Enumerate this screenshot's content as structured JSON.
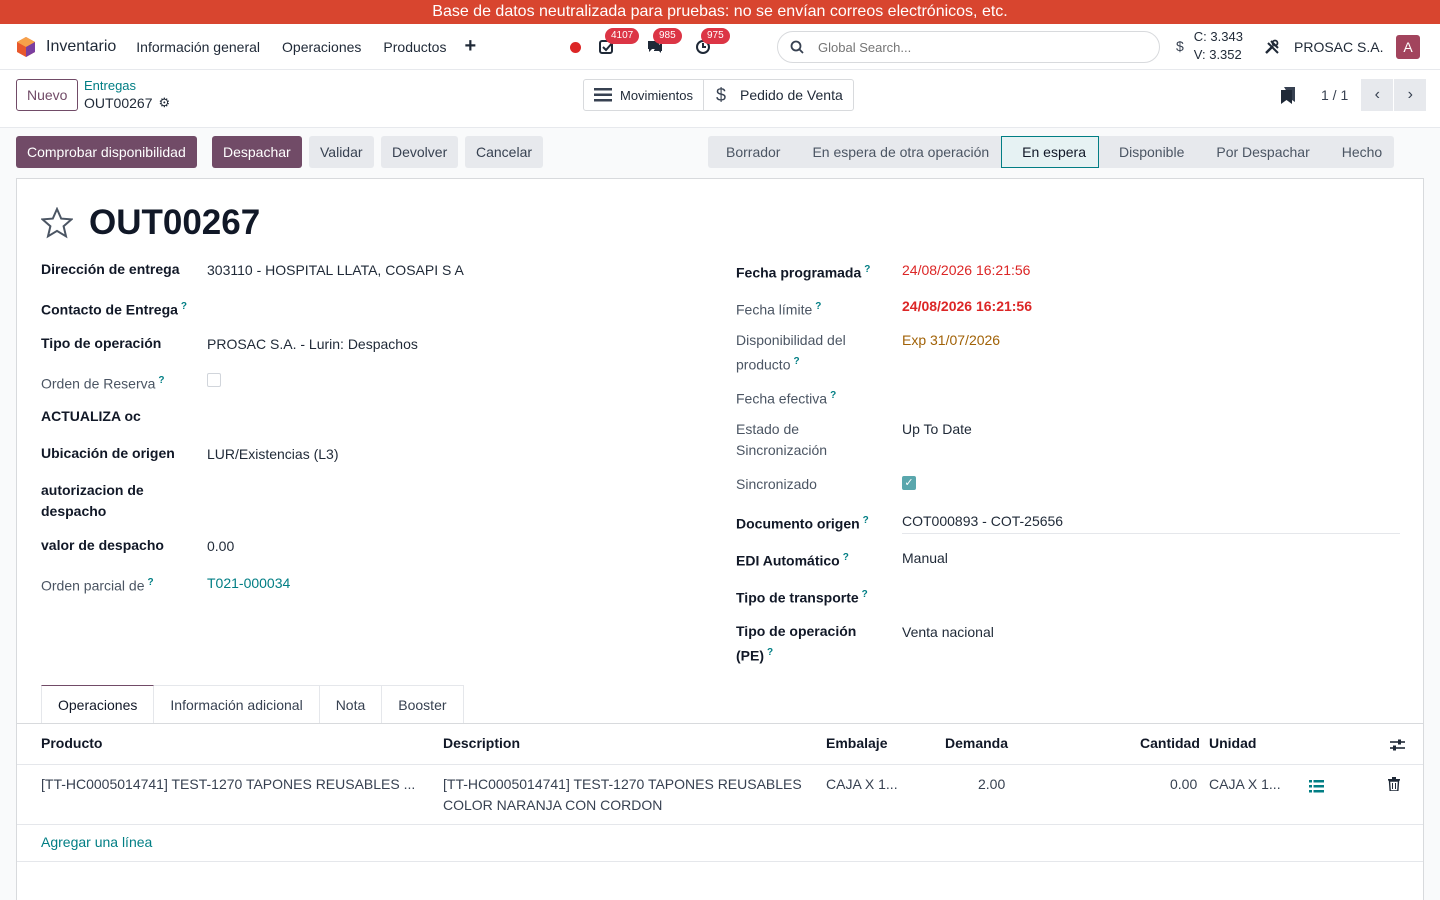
{
  "banner": "Base de datos neutralizada para pruebas: no se envían correos electrónicos, etc.",
  "nav": {
    "app_name": "Inventario",
    "menus": [
      "Información general",
      "Operaciones",
      "Productos"
    ],
    "plus_icon": "plus-icon",
    "activity_count": "4107",
    "messages_count": "985",
    "timer_count": "975",
    "search_placeholder": "Global Search...",
    "rate_c": "C: 3.343",
    "rate_v": "V: 3.352",
    "currency_symbol": "$",
    "company": "PROSAC S.A.",
    "avatar_letter": "A"
  },
  "control": {
    "new_label": "Nuevo",
    "breadcrumb_parent": "Entregas",
    "breadcrumb_current": "OUT00267",
    "smart_moves": "Movimientos",
    "smart_sale": "Pedido de Venta",
    "pager": "1 / 1"
  },
  "actions": {
    "check": "Comprobar disponibilidad",
    "dispatch": "Despachar",
    "validate": "Validar",
    "return": "Devolver",
    "cancel": "Cancelar"
  },
  "status": [
    "Borrador",
    "En espera de otra operación",
    "En espera",
    "Disponible",
    "Por Despachar",
    "Hecho"
  ],
  "status_active": "En espera",
  "record": {
    "title": "OUT00267",
    "left": {
      "delivery_address_label": "Dirección de entrega",
      "delivery_address": "303110 - HOSPITAL LLATA, COSAPI S A",
      "contact_label": "Contacto de Entrega",
      "op_type_label": "Tipo de operación",
      "op_type": "PROSAC S.A. - Lurin: Despachos",
      "reserve_label": "Orden de Reserva",
      "update_oc_label": "ACTUALIZA oc",
      "source_loc_label": "Ubicación de origen",
      "source_loc": "LUR/Existencias (L3)",
      "auth_label_1": "autorizacion de",
      "auth_label_2": "despacho",
      "dispatch_value_label": "valor de despacho",
      "dispatch_value": "0.00",
      "partial_label": "Orden parcial de",
      "partial": "T021-000034"
    },
    "right": {
      "scheduled_label": "Fecha programada",
      "scheduled": "24/08/2026 16:21:56",
      "deadline_label": "Fecha límite",
      "deadline": "24/08/2026 16:21:56",
      "availability_label_1": "Disponibilidad del",
      "availability_label_2": "producto",
      "availability": "Exp 31/07/2026",
      "effective_label": "Fecha efectiva",
      "sync_state_label_1": "Estado de",
      "sync_state_label_2": "Sincronización",
      "sync_state": "Up To Date",
      "synced_label": "Sincronizado",
      "origin_label": "Documento origen",
      "origin": "COT000893 - COT-25656",
      "edi_label": "EDI Automático",
      "edi": "Manual",
      "transport_label": "Tipo de transporte",
      "pe_op_label_1": "Tipo de operación",
      "pe_op_label_2": "(PE)",
      "pe_op": "Venta nacional"
    }
  },
  "tabs": [
    "Operaciones",
    "Información adicional",
    "Nota",
    "Booster"
  ],
  "table": {
    "headers": [
      "Producto",
      "Description",
      "Embalaje",
      "Demanda",
      "Cantidad",
      "Unidad"
    ],
    "row": {
      "product": "[TT-HC0005014741] TEST-1270 TAPONES REUSABLES ...",
      "description_1": "[TT-HC0005014741] TEST-1270 TAPONES REUSABLES",
      "description_2": "COLOR NARANJA CON CORDON",
      "packaging": "CAJA X 1...",
      "demand": "2.00",
      "quantity": "0.00",
      "unit": "CAJA X 1..."
    },
    "add_line": "Agregar una línea"
  }
}
